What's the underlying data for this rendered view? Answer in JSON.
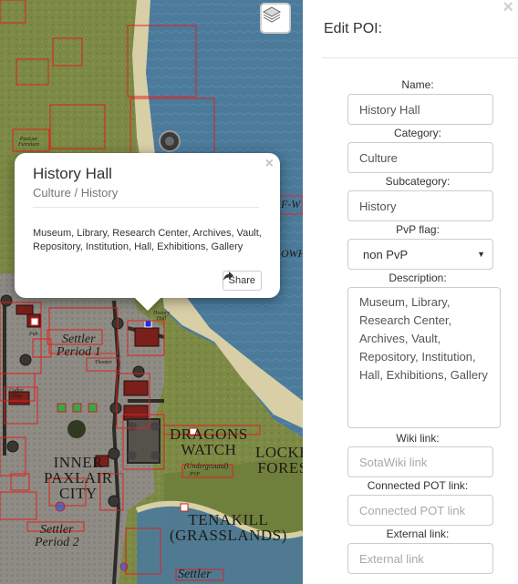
{
  "map": {
    "labels": {
      "settler_period_1_line1": "Settler",
      "settler_period_1_line2": "Period 1",
      "settler_period_2_line1": "Settler",
      "settler_period_2_line2": "Period 2",
      "inner_paxlair_line1": "INNER",
      "inner_paxlair_line2": "PAXLAIR",
      "inner_paxlair_line3": "CITY",
      "dragons_watch_line1": "DRAGONS",
      "dragons_watch_line2": "WATCH",
      "underground": "(Underground)",
      "pvp": "PVP",
      "tenakill_line1": "TENAKILL",
      "tenakill_line2": "(GRASSLANDS)",
      "lockb_line1": "LOCKB",
      "lockb_line2": "FORES",
      "settler_bottom": "Settler",
      "history_line1": "History",
      "history_line2": "Hall",
      "pub": "Pub",
      "theater": "Theater",
      "coffee_line1": "Coffee",
      "coffee_line2": "Shop",
      "paxlair_line1": "PaxLair",
      "paxlair_line2": "Furniture",
      "edge_text_1": "F-W",
      "edge_text_2": "OWH"
    },
    "layers_icon": "layers-icon"
  },
  "popup": {
    "title": "History Hall",
    "subtitle": "Culture / History",
    "description": "Museum, Library, Research Center, Archives, Vault, Repository, Institution, Hall, Exhibitions, Gallery",
    "share_label": "Share",
    "close_glyph": "×"
  },
  "panel": {
    "title": "Edit POI:",
    "close_glyph": "×",
    "fields": {
      "name": {
        "label": "Name:",
        "value": "History Hall"
      },
      "category": {
        "label": "Category:",
        "value": "Culture"
      },
      "subcategory": {
        "label": "Subcategory:",
        "value": "History"
      },
      "pvp": {
        "label": "PvP flag:",
        "value": "non PvP"
      },
      "description": {
        "label": "Description:",
        "value": "Museum, Library, Research Center, Archives, Vault, Repository, Institution, Hall, Exhibitions, Gallery"
      },
      "wiki": {
        "label": "Wiki link:",
        "placeholder": "SotaWiki link"
      },
      "pot": {
        "label": "Connected POT link:",
        "placeholder": "Connected POT link"
      },
      "external": {
        "label": "External link:",
        "placeholder": "External link"
      }
    }
  },
  "colors": {
    "water": "#4b7a9b",
    "grass": "#7c8a45",
    "city": "#8f8c86",
    "zone_outline": "#e0201c",
    "sand": "#d8cfa6"
  }
}
